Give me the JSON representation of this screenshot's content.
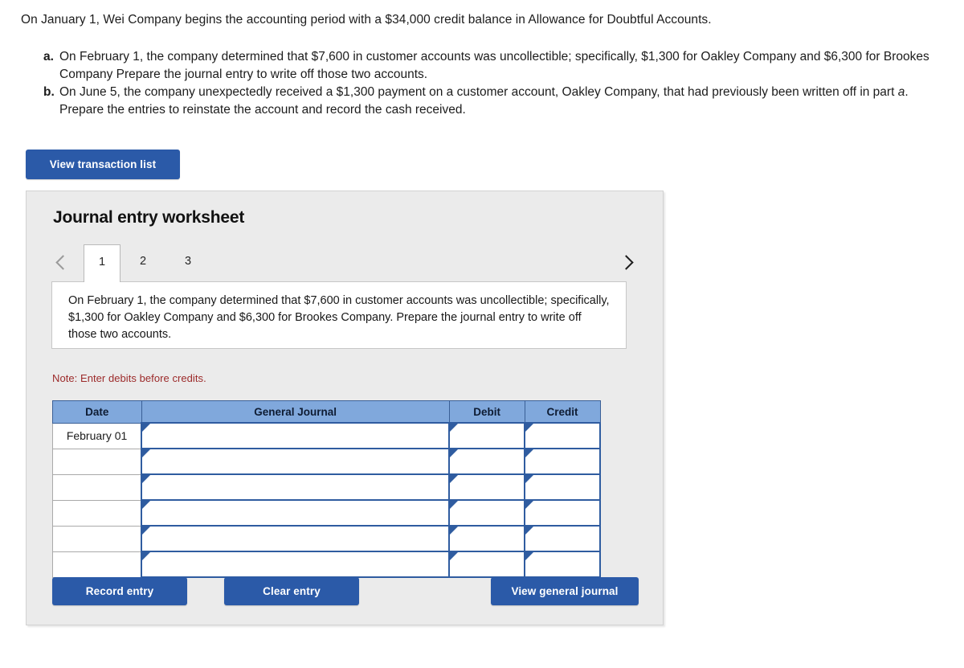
{
  "problem": {
    "intro": "On January 1, Wei Company begins the accounting period with a $34,000 credit balance in Allowance for Doubtful Accounts.",
    "parts": [
      {
        "label": "a.",
        "text_before_italic": "On February 1, the company determined that $7,600 in customer accounts was uncollectible; specifically, $1,300 for Oakley Company and $6,300 for Brookes Company Prepare the journal entry to write off those two accounts.",
        "italic": "",
        "text_after_italic": ""
      },
      {
        "label": "b.",
        "text_before_italic": "On June 5, the company unexpectedly received a $1,300 payment on a customer account, Oakley Company, that had previously been written off in part ",
        "italic": "a",
        "text_after_italic": ". Prepare the entries to reinstate the account and record the cash received."
      }
    ]
  },
  "toolbar": {
    "view_transaction_list_label": "View transaction list"
  },
  "worksheet": {
    "title": "Journal entry worksheet",
    "prev_arrow_icon": "chevron-left-icon",
    "next_arrow_icon": "chevron-right-icon",
    "tabs": [
      {
        "label": "1",
        "active": true
      },
      {
        "label": "2",
        "active": false
      },
      {
        "label": "3",
        "active": false
      }
    ],
    "description": "On February 1, the company determined that $7,600 in customer accounts was uncollectible; specifically, $1,300 for Oakley Company and $6,300 for Brookes Company. Prepare the journal entry to write off those two accounts.",
    "note": "Note: Enter debits before credits.",
    "table": {
      "columns": [
        "Date",
        "General Journal",
        "Debit",
        "Credit"
      ],
      "rows": [
        {
          "date": "February 01",
          "general_journal": "",
          "debit": "",
          "credit": ""
        },
        {
          "date": "",
          "general_journal": "",
          "debit": "",
          "credit": ""
        },
        {
          "date": "",
          "general_journal": "",
          "debit": "",
          "credit": ""
        },
        {
          "date": "",
          "general_journal": "",
          "debit": "",
          "credit": ""
        },
        {
          "date": "",
          "general_journal": "",
          "debit": "",
          "credit": ""
        },
        {
          "date": "",
          "general_journal": "",
          "debit": "",
          "credit": ""
        }
      ]
    },
    "buttons": {
      "record_entry_label": "Record entry",
      "clear_entry_label": "Clear entry",
      "view_general_journal_label": "View general journal"
    }
  },
  "colors": {
    "button_blue": "#2b5aa8",
    "table_header_blue": "#80a8dc",
    "input_border_blue": "#2f5ca0",
    "note_red": "#9c2a2a",
    "panel_gray": "#ebebeb"
  }
}
